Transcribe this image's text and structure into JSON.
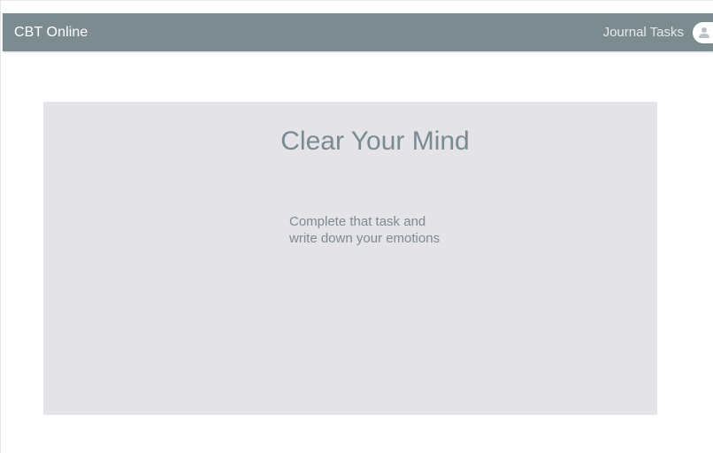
{
  "navbar": {
    "brand": "CBT Online",
    "links": [
      "Journal Tasks"
    ],
    "avatar_icon": "user-icon"
  },
  "main": {
    "title": "Clear Your Mind",
    "description_lines": [
      "Complete that task and",
      "write down your emotions"
    ]
  },
  "colors": {
    "navbar": "#7b8b90",
    "panel": "#e4e3e8",
    "accent_text": "#788b91"
  }
}
